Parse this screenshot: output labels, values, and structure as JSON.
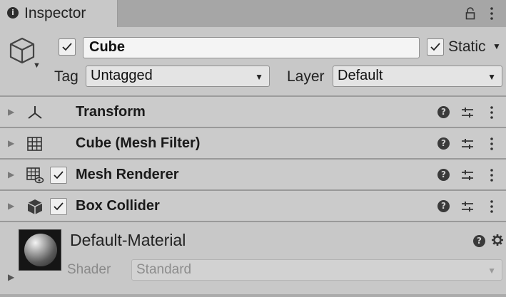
{
  "tab": {
    "title": "Inspector",
    "info_icon": "info-icon",
    "lock_icon": "lock-icon",
    "menu_icon": "kebab-menu-icon"
  },
  "header": {
    "gameobject_icon": "cube-icon",
    "active": true,
    "name": "Cube",
    "static_checked": true,
    "static_label": "Static",
    "tag_label": "Tag",
    "tag_value": "Untagged",
    "layer_label": "Layer",
    "layer_value": "Default"
  },
  "components": [
    {
      "name": "Transform",
      "icon": "transform-icon",
      "has_checkbox": false
    },
    {
      "name": "Cube (Mesh Filter)",
      "icon": "mesh-filter-icon",
      "has_checkbox": false
    },
    {
      "name": "Mesh Renderer",
      "icon": "mesh-renderer-icon",
      "has_checkbox": true,
      "enabled": true
    },
    {
      "name": "Box Collider",
      "icon": "box-collider-icon",
      "has_checkbox": true,
      "enabled": true
    }
  ],
  "material": {
    "name": "Default-Material",
    "shader_label": "Shader",
    "shader_value": "Standard"
  },
  "colors": {
    "panel": "#c8c8c8",
    "tabbar": "#a6a6a6",
    "separator": "#999999"
  }
}
